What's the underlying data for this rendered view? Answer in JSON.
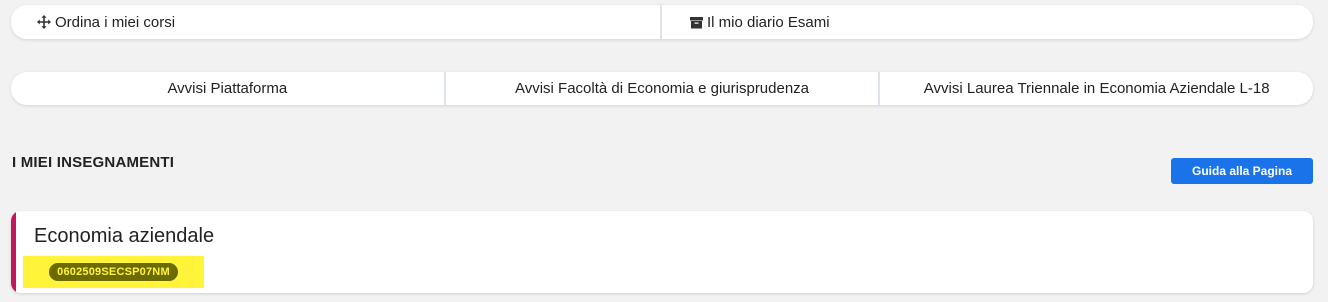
{
  "top_bar": {
    "sort_courses_label": "Ordina i miei corsi",
    "sort_icon": "move-arrows-icon",
    "exam_diary_label": "Il mio diario Esami",
    "exam_icon": "archive-box-icon"
  },
  "notices": {
    "tabs": [
      {
        "label": "Avvisi Piattaforma"
      },
      {
        "label": "Avvisi Facoltà di Economia e giurisprudenza"
      },
      {
        "label": "Avvisi Laurea Triennale in Economia Aziendale L-18"
      }
    ]
  },
  "section": {
    "title": "I MIEI INSEGNAMENTI",
    "guide_button_label": "Guida alla Pagina"
  },
  "courses": [
    {
      "name": "Economia aziendale",
      "code": "0602509SECSP07NM",
      "accent_color": "#c2185b"
    }
  ],
  "colors": {
    "primary_button": "#1a73e8",
    "highlight": "#fff43a"
  }
}
